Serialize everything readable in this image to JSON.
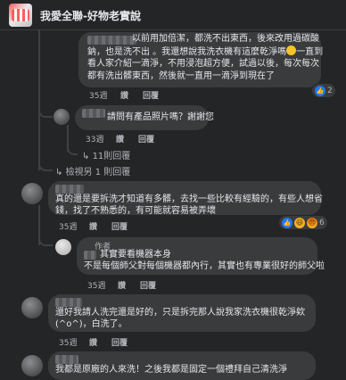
{
  "header": {
    "title": "我愛全聯-好物老實說"
  },
  "comments": [
    {
      "id": "c1",
      "lines": [
        "以前用加倍潔，都洗不出東西，後來改用過碳酸",
        "鈉，也是洗不出 。我還想說我洗衣機有這麼乾淨嗎",
        "看人家介紹一滴淨，不用浸泡超方便，試過以後，每次每次",
        "都有洗出髒東西，然後就一直用一滴淨到現在了"
      ],
      "emoji_after_line2": "😊",
      "line2_tail": "一直到",
      "time": "35週",
      "actions": [
        "讚",
        "回覆"
      ],
      "reactions": {
        "count": "2",
        "types": [
          "like-icon"
        ]
      }
    },
    {
      "id": "c2",
      "lines": [
        "請問有產品照片嗎？謝謝您"
      ],
      "time": "33週",
      "actions": [
        "讚",
        "回覆"
      ]
    },
    {
      "id": "c3",
      "lines": [
        "真的還是要拆洗才知道有多髒，去找一些比較有經驗的，有些人想省",
        "錢，找了不熟悉的，有可能就容易被弄壞"
      ],
      "time": "35週",
      "actions": [
        "讚",
        "回覆"
      ],
      "reactions": {
        "count": "6",
        "types": [
          "like-icon",
          "haha-icon",
          "angry-icon"
        ]
      }
    },
    {
      "id": "c3r1",
      "badge": "作者",
      "lines": [
        "其實要看機器本身",
        "不是每個師父對每個機器都內行，其實也有專業很好的師父啦"
      ],
      "time": "35週",
      "actions": [
        "讚",
        "回覆"
      ]
    },
    {
      "id": "c4",
      "lines": [
        "還好我請人洗完還是好的，只是拆完那人說我家洗衣機很乾淨欸",
        "(^o^)，白洗了。"
      ],
      "time": "35週",
      "actions": [
        "讚",
        "回覆"
      ]
    },
    {
      "id": "c5",
      "lines": [
        "我都是原廠的人來洗！之後我都是固定一個禮拜自己清洗淨"
      ]
    }
  ],
  "threads": {
    "c2_more_replies": "11則回覆",
    "view_more": "檢視另 1 則回覆"
  }
}
